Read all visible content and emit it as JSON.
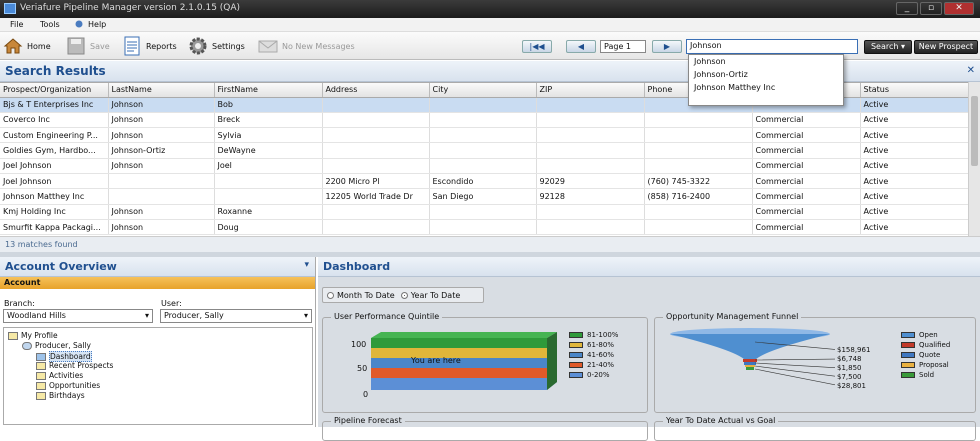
{
  "window": {
    "title": "Veriafure Pipeline Manager version 2.1.0.15 (QA)",
    "controls": [
      "_",
      "▫",
      "✕"
    ]
  },
  "menu": [
    "File",
    "Tools",
    "Help"
  ],
  "toolbar": {
    "home": "Home",
    "save": "Save",
    "reports": "Reports",
    "settings": "Settings",
    "messages": "No New Messages",
    "page": "Page 1",
    "search_value": "Johnson",
    "search": "Search",
    "new_prospect": "New Prospect",
    "nav_first": "|◀◀",
    "nav_prev": "◀",
    "nav_next": "▶"
  },
  "search_results": {
    "title": "Search Results",
    "columns": [
      "Prospect/Organization",
      "LastName",
      "FirstName",
      "Address",
      "City",
      "ZIP",
      "Phone",
      "",
      "Status"
    ],
    "rows": [
      [
        "Bjs & T Enterprises Inc",
        "Johnson",
        "Bob",
        "",
        "",
        "",
        "",
        "",
        "Active"
      ],
      [
        "Coverco Inc",
        "Johnson",
        "Breck",
        "",
        "",
        "",
        "",
        "Commercial",
        "Active"
      ],
      [
        "Custom Engineering P...",
        "Johnson",
        "Sylvia",
        "",
        "",
        "",
        "",
        "Commercial",
        "Active"
      ],
      [
        "Goldies Gym, Hardbo...",
        "Johnson-Ortiz",
        "DeWayne",
        "",
        "",
        "",
        "",
        "Commercial",
        "Active"
      ],
      [
        "Joel Johnson",
        "Johnson",
        "Joel",
        "",
        "",
        "",
        "",
        "Commercial",
        "Active"
      ],
      [
        "Joel Johnson",
        "",
        "",
        "2200 Micro Pl",
        "Escondido",
        "92029",
        "(760) 745-3322",
        "Commercial",
        "Active"
      ],
      [
        "Johnson Matthey Inc",
        "",
        "",
        "12205 World Trade Dr",
        "San Diego",
        "92128",
        "(858) 716-2400",
        "Commercial",
        "Active"
      ],
      [
        "Kmj Holding Inc",
        "Johnson",
        "Roxanne",
        "",
        "",
        "",
        "",
        "Commercial",
        "Active"
      ],
      [
        "Smurfit Kappa Packagi...",
        "Johnson",
        "Doug",
        "",
        "",
        "",
        "",
        "Commercial",
        "Active"
      ]
    ],
    "count": "13 matches found",
    "close": "✕"
  },
  "autocomplete": [
    "Johnson",
    "Johnson-Ortiz",
    "Johnson Matthey Inc"
  ],
  "account_overview": {
    "title": "Account Overview",
    "section": "Account",
    "branch_label": "Branch:",
    "branch_value": "Woodland Hills",
    "user_label": "User:",
    "user_value": "Producer, Sally",
    "tree": [
      "My Profile",
      "Producer, Sally",
      "Dashboard",
      "Recent Prospects",
      "Activities",
      "Opportunities",
      "Birthdays"
    ]
  },
  "dashboard": {
    "title": "Dashboard",
    "opt_month": "Month To Date",
    "opt_year": "Year To Date",
    "quintile": {
      "title": "User Performance Quintile",
      "ticks": [
        "100",
        "50",
        "0"
      ],
      "marker": "You are here",
      "legend": [
        "81-100%",
        "61-80%",
        "41-60%",
        "21-40%",
        "0-20%"
      ],
      "colors": [
        "#2f9a3a",
        "#e0b63a",
        "#4a86c8",
        "#e05a2a",
        "#5c8fd6"
      ]
    },
    "funnel": {
      "title": "Opportunity Management Funnel",
      "values": [
        "$158,961",
        "$6,748",
        "$1,850",
        "$7,500",
        "$28,801"
      ],
      "legend": [
        "Open",
        "Qualified",
        "Quote",
        "Proposal",
        "Sold"
      ],
      "colors": [
        "#4f8fd0",
        "#c23a2a",
        "#3f77c0",
        "#e8b040",
        "#3a9a3a"
      ]
    },
    "pipeline": "Pipeline Forecast",
    "ytd": "Year To Date Actual vs Goal"
  }
}
